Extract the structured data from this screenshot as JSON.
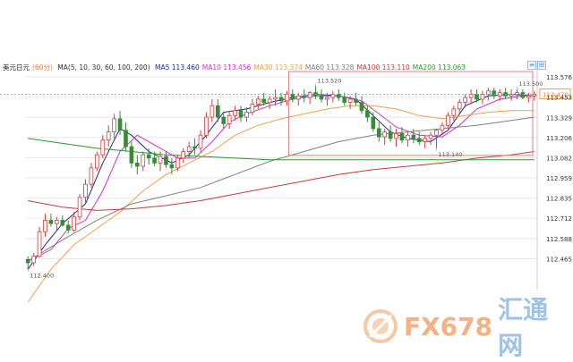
{
  "chart_data": {
    "type": "candlestick",
    "legend": {
      "symbol": "美元日元",
      "period": "(60分)",
      "ma_params": "MA(5, 10, 30, 60, 100, 200)",
      "items": [
        {
          "label": "MA5",
          "value": "113.460",
          "color": "#1a2a8c"
        },
        {
          "label": "MA10",
          "value": "113.456",
          "color": "#d42fd4"
        },
        {
          "label": "MA30",
          "value": "113.374",
          "color": "#f0a050"
        },
        {
          "label": "MA60",
          "value": "113.328",
          "color": "#808080"
        },
        {
          "label": "MA100",
          "value": "113.110",
          "color": "#c04040"
        },
        {
          "label": "MA200",
          "value": "113.063",
          "color": "#2a9a2a"
        }
      ]
    },
    "y_ticks": [
      "113.576",
      "113.453",
      "113.329",
      "113.206",
      "113.082",
      "112.959",
      "112.835",
      "112.712",
      "112.588",
      "112.465"
    ],
    "ylim": [
      112.38,
      113.62
    ],
    "current_price": "113.470",
    "annotations": [
      {
        "label": "112.400",
        "idx": 0,
        "value": 112.4,
        "pos": "below"
      },
      {
        "label": "113.520",
        "idx": 50,
        "value": 113.52,
        "pos": "above"
      },
      {
        "label": "113.140",
        "idx": 71,
        "value": 113.14,
        "pos": "below"
      },
      {
        "label": "113.500",
        "idx": 85,
        "value": 113.5,
        "pos": "above"
      }
    ],
    "candles": [
      [
        112.46,
        112.48,
        112.4,
        112.44
      ],
      [
        112.44,
        112.5,
        112.42,
        112.48
      ],
      [
        112.48,
        112.66,
        112.47,
        112.63
      ],
      [
        112.63,
        112.74,
        112.6,
        112.7
      ],
      [
        112.7,
        112.74,
        112.66,
        112.68
      ],
      [
        112.68,
        112.72,
        112.64,
        112.7
      ],
      [
        112.7,
        112.73,
        112.66,
        112.67
      ],
      [
        112.67,
        112.7,
        112.62,
        112.64
      ],
      [
        112.64,
        112.75,
        112.63,
        112.72
      ],
      [
        112.72,
        112.86,
        112.7,
        112.84
      ],
      [
        112.84,
        112.95,
        112.8,
        112.92
      ],
      [
        112.92,
        113.05,
        112.9,
        113.02
      ],
      [
        113.02,
        113.12,
        113.0,
        113.1
      ],
      [
        113.1,
        113.22,
        113.08,
        113.19
      ],
      [
        113.19,
        113.28,
        113.15,
        113.24
      ],
      [
        113.24,
        113.35,
        113.2,
        113.32
      ],
      [
        113.32,
        113.37,
        113.22,
        113.25
      ],
      [
        113.25,
        113.3,
        113.12,
        113.15
      ],
      [
        113.15,
        113.18,
        113.02,
        113.05
      ],
      [
        113.05,
        113.1,
        112.98,
        113.03
      ],
      [
        113.03,
        113.12,
        113.0,
        113.1
      ],
      [
        113.1,
        113.14,
        113.04,
        113.08
      ],
      [
        113.08,
        113.12,
        113.03,
        113.05
      ],
      [
        113.05,
        113.12,
        113.0,
        113.09
      ],
      [
        113.09,
        113.12,
        113.02,
        113.04
      ],
      [
        113.04,
        113.08,
        112.98,
        113.02
      ],
      [
        113.02,
        113.1,
        113.0,
        113.08
      ],
      [
        113.08,
        113.14,
        113.05,
        113.12
      ],
      [
        113.12,
        113.18,
        113.08,
        113.15
      ],
      [
        113.15,
        113.2,
        113.1,
        113.14
      ],
      [
        113.14,
        113.25,
        113.12,
        113.22
      ],
      [
        113.22,
        113.36,
        113.2,
        113.33
      ],
      [
        113.33,
        113.44,
        113.3,
        113.4
      ],
      [
        113.4,
        113.44,
        113.3,
        113.33
      ],
      [
        113.33,
        113.36,
        113.26,
        113.29
      ],
      [
        113.29,
        113.36,
        113.26,
        113.34
      ],
      [
        113.34,
        113.4,
        113.31,
        113.37
      ],
      [
        113.37,
        113.4,
        113.3,
        113.33
      ],
      [
        113.33,
        113.39,
        113.3,
        113.36
      ],
      [
        113.36,
        113.44,
        113.34,
        113.41
      ],
      [
        113.41,
        113.46,
        113.38,
        113.44
      ],
      [
        113.44,
        113.48,
        113.4,
        113.42
      ],
      [
        113.42,
        113.46,
        113.38,
        113.44
      ],
      [
        113.44,
        113.5,
        113.4,
        113.45
      ],
      [
        113.45,
        113.48,
        113.4,
        113.43
      ],
      [
        113.43,
        113.49,
        113.4,
        113.47
      ],
      [
        113.47,
        113.5,
        113.42,
        113.44
      ],
      [
        113.44,
        113.48,
        113.4,
        113.46
      ],
      [
        113.46,
        113.5,
        113.42,
        113.45
      ],
      [
        113.45,
        113.49,
        113.41,
        113.48
      ],
      [
        113.48,
        113.52,
        113.44,
        113.46
      ],
      [
        113.46,
        113.5,
        113.42,
        113.44
      ],
      [
        113.44,
        113.48,
        113.4,
        113.45
      ],
      [
        113.45,
        113.49,
        113.42,
        113.47
      ],
      [
        113.47,
        113.5,
        113.43,
        113.45
      ],
      [
        113.45,
        113.48,
        113.4,
        113.42
      ],
      [
        113.42,
        113.46,
        113.38,
        113.44
      ],
      [
        113.44,
        113.48,
        113.4,
        113.42
      ],
      [
        113.42,
        113.46,
        113.35,
        113.37
      ],
      [
        113.37,
        113.4,
        113.3,
        113.33
      ],
      [
        113.33,
        113.36,
        113.24,
        113.26
      ],
      [
        113.26,
        113.3,
        113.18,
        113.21
      ],
      [
        113.21,
        113.26,
        113.16,
        113.24
      ],
      [
        113.24,
        113.28,
        113.18,
        113.2
      ],
      [
        113.2,
        113.26,
        113.15,
        113.23
      ],
      [
        113.23,
        113.27,
        113.17,
        113.19
      ],
      [
        113.19,
        113.24,
        113.15,
        113.22
      ],
      [
        113.22,
        113.26,
        113.17,
        113.2
      ],
      [
        113.2,
        113.24,
        113.16,
        113.18
      ],
      [
        113.18,
        113.22,
        113.14,
        113.2
      ],
      [
        113.2,
        113.24,
        113.16,
        113.22
      ],
      [
        113.22,
        113.26,
        113.14,
        113.25
      ],
      [
        113.25,
        113.3,
        113.22,
        113.28
      ],
      [
        113.28,
        113.36,
        113.26,
        113.34
      ],
      [
        113.34,
        113.4,
        113.31,
        113.38
      ],
      [
        113.38,
        113.44,
        113.35,
        113.42
      ],
      [
        113.42,
        113.47,
        113.39,
        113.45
      ],
      [
        113.45,
        113.5,
        113.41,
        113.47
      ],
      [
        113.47,
        113.5,
        113.42,
        113.44
      ],
      [
        113.44,
        113.49,
        113.41,
        113.47
      ],
      [
        113.47,
        113.51,
        113.43,
        113.49
      ],
      [
        113.49,
        113.51,
        113.44,
        113.46
      ],
      [
        113.46,
        113.5,
        113.43,
        113.48
      ],
      [
        113.48,
        113.51,
        113.44,
        113.46
      ],
      [
        113.46,
        113.5,
        113.43,
        113.47
      ],
      [
        113.47,
        113.5,
        113.44,
        113.48
      ],
      [
        113.48,
        113.5,
        113.44,
        113.45
      ],
      [
        113.45,
        113.48,
        113.42,
        113.46
      ],
      [
        113.46,
        113.49,
        113.43,
        113.47
      ]
    ],
    "ma_lines": {
      "MA5": [
        [
          0,
          112.4
        ],
        [
          3,
          112.55
        ],
        [
          6,
          112.68
        ],
        [
          10,
          112.8
        ],
        [
          13,
          113.05
        ],
        [
          16,
          113.26
        ],
        [
          18,
          113.22
        ],
        [
          21,
          113.12
        ],
        [
          25,
          113.05
        ],
        [
          28,
          113.1
        ],
        [
          31,
          113.22
        ],
        [
          34,
          113.36
        ],
        [
          38,
          113.38
        ],
        [
          42,
          113.42
        ],
        [
          46,
          113.45
        ],
        [
          50,
          113.47
        ],
        [
          54,
          113.46
        ],
        [
          57,
          113.44
        ],
        [
          60,
          113.34
        ],
        [
          63,
          113.24
        ],
        [
          66,
          113.2
        ],
        [
          70,
          113.18
        ],
        [
          73,
          113.25
        ],
        [
          76,
          113.4
        ],
        [
          80,
          113.46
        ],
        [
          84,
          113.47
        ],
        [
          88,
          113.46
        ]
      ],
      "MA10": [
        [
          0,
          112.45
        ],
        [
          4,
          112.52
        ],
        [
          7,
          112.65
        ],
        [
          10,
          112.7
        ],
        [
          13,
          112.88
        ],
        [
          16,
          113.12
        ],
        [
          19,
          113.22
        ],
        [
          22,
          113.16
        ],
        [
          26,
          113.08
        ],
        [
          29,
          113.08
        ],
        [
          32,
          113.18
        ],
        [
          35,
          113.3
        ],
        [
          38,
          113.35
        ],
        [
          42,
          113.4
        ],
        [
          46,
          113.44
        ],
        [
          50,
          113.46
        ],
        [
          54,
          113.46
        ],
        [
          58,
          113.43
        ],
        [
          61,
          113.35
        ],
        [
          64,
          113.27
        ],
        [
          68,
          113.22
        ],
        [
          72,
          113.21
        ],
        [
          75,
          113.28
        ],
        [
          78,
          113.38
        ],
        [
          82,
          113.44
        ],
        [
          86,
          113.46
        ],
        [
          88,
          113.46
        ]
      ],
      "MA30": [
        [
          0,
          112.2
        ],
        [
          4,
          112.4
        ],
        [
          8,
          112.55
        ],
        [
          12,
          112.65
        ],
        [
          16,
          112.75
        ],
        [
          20,
          112.88
        ],
        [
          24,
          112.98
        ],
        [
          28,
          113.05
        ],
        [
          32,
          113.12
        ],
        [
          36,
          113.22
        ],
        [
          40,
          113.28
        ],
        [
          44,
          113.32
        ],
        [
          48,
          113.35
        ],
        [
          52,
          113.38
        ],
        [
          56,
          113.4
        ],
        [
          60,
          113.4
        ],
        [
          64,
          113.38
        ],
        [
          68,
          113.34
        ],
        [
          72,
          113.32
        ],
        [
          76,
          113.34
        ],
        [
          80,
          113.36
        ],
        [
          84,
          113.37
        ],
        [
          88,
          113.37
        ]
      ],
      "MA60": [
        [
          0,
          112.45
        ],
        [
          6,
          112.58
        ],
        [
          12,
          112.7
        ],
        [
          18,
          112.8
        ],
        [
          24,
          112.85
        ],
        [
          30,
          112.9
        ],
        [
          36,
          112.98
        ],
        [
          42,
          113.06
        ],
        [
          48,
          113.12
        ],
        [
          54,
          113.18
        ],
        [
          60,
          113.22
        ],
        [
          66,
          113.24
        ],
        [
          72,
          113.26
        ],
        [
          78,
          113.28
        ],
        [
          84,
          113.31
        ],
        [
          88,
          113.33
        ]
      ],
      "MA100": [
        [
          0,
          112.82
        ],
        [
          6,
          112.78
        ],
        [
          12,
          112.76
        ],
        [
          18,
          112.77
        ],
        [
          24,
          112.79
        ],
        [
          30,
          112.82
        ],
        [
          36,
          112.86
        ],
        [
          42,
          112.9
        ],
        [
          48,
          112.94
        ],
        [
          54,
          112.98
        ],
        [
          60,
          113.01
        ],
        [
          66,
          113.03
        ],
        [
          72,
          113.05
        ],
        [
          78,
          113.08
        ],
        [
          84,
          113.1
        ],
        [
          88,
          113.12
        ]
      ],
      "MA200": [
        [
          0,
          113.2
        ],
        [
          6,
          113.17
        ],
        [
          12,
          113.14
        ],
        [
          18,
          113.12
        ],
        [
          24,
          113.1
        ],
        [
          30,
          113.09
        ],
        [
          36,
          113.08
        ],
        [
          42,
          113.07
        ],
        [
          48,
          113.07
        ],
        [
          54,
          113.07
        ],
        [
          60,
          113.07
        ],
        [
          66,
          113.07
        ],
        [
          72,
          113.07
        ],
        [
          78,
          113.07
        ],
        [
          84,
          113.07
        ],
        [
          88,
          113.07
        ]
      ]
    },
    "colors": {
      "up": "#d04040",
      "down": "#3a8a3a",
      "grid": "#e8e8e8",
      "price_line": "#7aa6d6",
      "box": "#e08080",
      "axis_text": "#333333",
      "label_text": "#555555"
    }
  },
  "watermark": {
    "brand": "FX678",
    "brand2": "汇通网"
  },
  "toolbar": {
    "btn1": "≡",
    "btn2": "⊞"
  }
}
